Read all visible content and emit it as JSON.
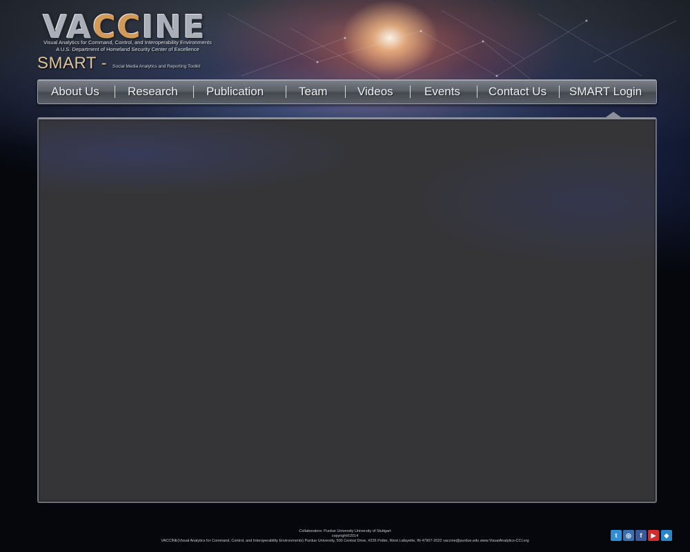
{
  "brand": {
    "logo_pre": "VA",
    "logo_cc": "CC",
    "logo_post": "INE",
    "tagline": "Visual Analytics for Command, Control, and Interoperability Environments",
    "subtagline": "A U.S. Department of Homeland Security Center of Excellence",
    "product": "SMART -",
    "product_sub": "Social Media Analytics and Reporting Toolkit",
    "logo_text_color": "#a9aeb8",
    "logo_accent_color": "#d39a57"
  },
  "nav": {
    "items": [
      {
        "label": "About Us"
      },
      {
        "label": "Research"
      },
      {
        "label": "Publication"
      },
      {
        "label": "Team"
      },
      {
        "label": "Videos"
      },
      {
        "label": "Events"
      },
      {
        "label": "Contact Us"
      },
      {
        "label": "SMART Login"
      }
    ]
  },
  "footer": {
    "collaborators": "Collaborators:    Purdue University    University of Stuttgart",
    "copyright": "copyright©2014",
    "address": "VACCINE(Visual Analytics for Command, Control, and Interoperability Environments)   Purdue University, 500 Central Drive, #226 Potter, West Lafayette, IN 47907-2022   vaccine@purdue.edu   www.VisualAnalytics-CCI.org"
  },
  "social": [
    {
      "icon": "twitter-icon",
      "glyph": "t",
      "color": "#2f8fd6"
    },
    {
      "icon": "instagram-icon",
      "glyph": "◎",
      "color": "#3a6fb0"
    },
    {
      "icon": "facebook-icon",
      "glyph": "f",
      "color": "#3b5a9a"
    },
    {
      "icon": "youtube-icon",
      "glyph": "▶",
      "color": "#d42c2c"
    },
    {
      "icon": "link-icon",
      "glyph": "◆",
      "color": "#2a86c8"
    }
  ]
}
